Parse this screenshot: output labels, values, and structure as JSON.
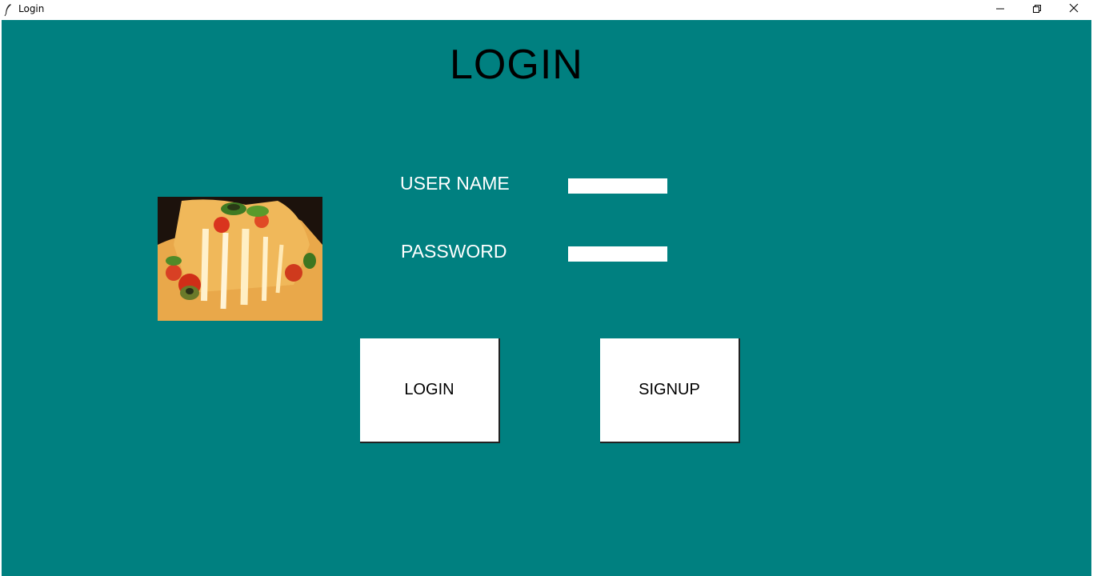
{
  "window": {
    "title": "Login",
    "icon": "feather-icon",
    "controls": [
      "minimize-icon",
      "restore-icon",
      "close-icon"
    ]
  },
  "main": {
    "heading": "LOGIN",
    "background_color": "#008080",
    "image": {
      "subject": "pizza-slice"
    },
    "username": {
      "label": "USER NAME",
      "value": ""
    },
    "password": {
      "label": "PASSWORD",
      "value": ""
    },
    "buttons": {
      "login": "LOGIN",
      "signup": "SIGNUP"
    }
  }
}
